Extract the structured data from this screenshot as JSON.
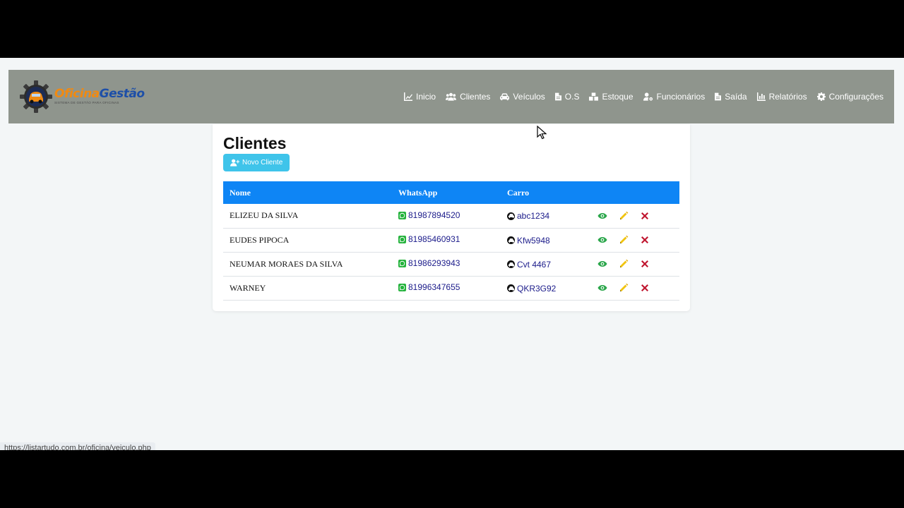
{
  "brand": {
    "title_part1": "Oficina",
    "title_part2": "Gestão",
    "subtitle": "SISTEMA DE GESTÃO PARA OFICINAS"
  },
  "nav": [
    {
      "label": "Inicio",
      "icon": "chart-line-icon"
    },
    {
      "label": "Clientes",
      "icon": "users-icon"
    },
    {
      "label": "Veículos",
      "icon": "car-icon"
    },
    {
      "label": "O.S",
      "icon": "file-icon"
    },
    {
      "label": "Estoque",
      "icon": "boxes-icon"
    },
    {
      "label": "Funcionários",
      "icon": "user-gear-icon"
    },
    {
      "label": "Saída",
      "icon": "file-icon"
    },
    {
      "label": "Relatórios",
      "icon": "chart-bar-icon"
    },
    {
      "label": "Configurações",
      "icon": "gear-icon"
    }
  ],
  "page": {
    "title": "Clientes",
    "new_button_label": "Novo Cliente"
  },
  "table": {
    "headers": [
      "Nome",
      "WhatsApp",
      "Carro"
    ],
    "rows": [
      {
        "nome": "ELIZEU DA SILVA",
        "whatsapp": "81987894520",
        "carro": "abc1234"
      },
      {
        "nome": "EUDES PIPOCA",
        "whatsapp": "81985460931",
        "carro": "Kfw5948"
      },
      {
        "nome": "NEUMAR MORAES DA SILVA",
        "whatsapp": "81986293943",
        "carro": "Cvt 4467"
      },
      {
        "nome": "WARNEY",
        "whatsapp": "81996347655",
        "carro": "QKR3G92"
      }
    ]
  },
  "status_bar": {
    "url": "https://listartudo.com.br/oficina/veiculo.php"
  },
  "colors": {
    "navbar": "#8f958d",
    "header_row": "#0e85f5",
    "button": "#3fc4ea",
    "view": "#2aa64a",
    "edit": "#f1c40f",
    "delete": "#c0152f"
  }
}
